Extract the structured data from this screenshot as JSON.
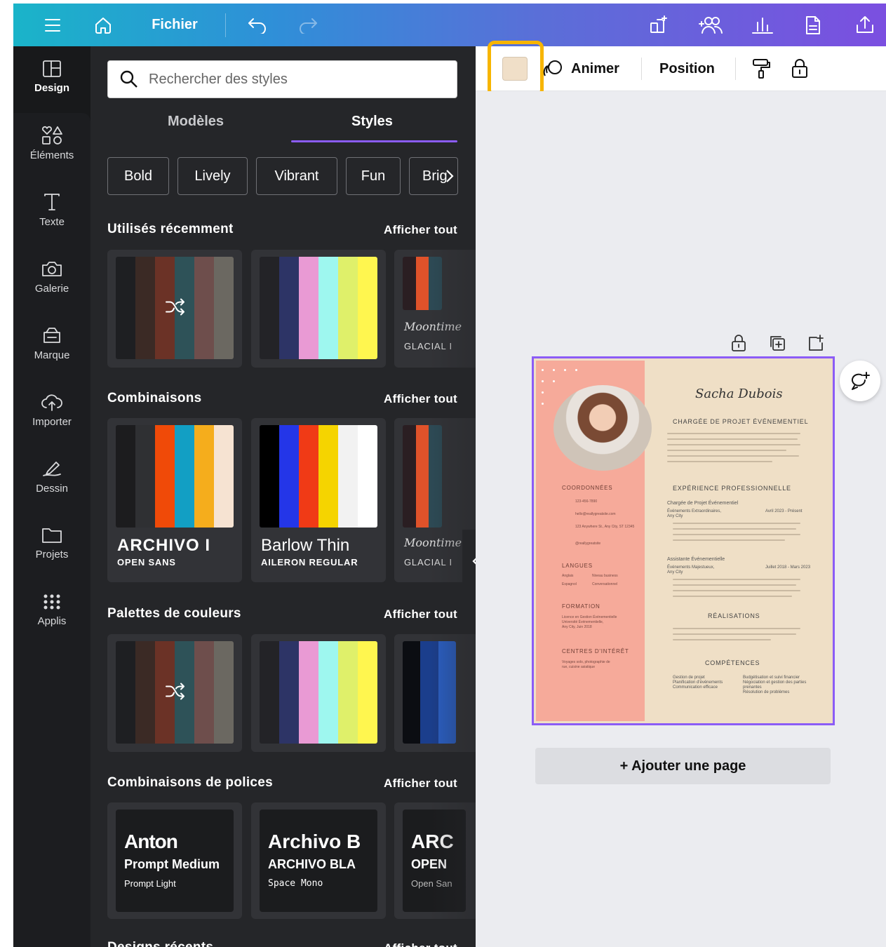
{
  "topbar": {
    "file_label": "Fichier",
    "icons": [
      "menu-icon",
      "home-icon",
      "undo-icon",
      "redo-icon",
      "resize-icon",
      "share-people-icon",
      "insights-icon",
      "notes-icon",
      "export-icon"
    ]
  },
  "rail": {
    "items": [
      {
        "label": "Design",
        "icon": "layout-icon"
      },
      {
        "label": "Éléments",
        "icon": "shapes-icon"
      },
      {
        "label": "Texte",
        "icon": "text-icon"
      },
      {
        "label": "Galerie",
        "icon": "camera-icon"
      },
      {
        "label": "Marque",
        "icon": "brand-icon"
      },
      {
        "label": "Importer",
        "icon": "upload-cloud-icon"
      },
      {
        "label": "Dessin",
        "icon": "draw-icon"
      },
      {
        "label": "Projets",
        "icon": "folder-icon"
      },
      {
        "label": "Applis",
        "icon": "apps-grid-icon"
      }
    ]
  },
  "panel": {
    "search_placeholder": "Rechercher des styles",
    "tabs": [
      "Modèles",
      "Styles"
    ],
    "active_tab": "Styles",
    "chips": [
      "Bold",
      "Lively",
      "Vibrant",
      "Fun",
      "Brig"
    ],
    "sections": {
      "recent": {
        "title": "Utilisés récemment",
        "link": "Afficher tout"
      },
      "combos": {
        "title": "Combinaisons",
        "link": "Afficher tout"
      },
      "palettes": {
        "title": "Palettes de couleurs",
        "link": "Afficher tout"
      },
      "fonts": {
        "title": "Combinaisons de polices",
        "link": "Afficher tout"
      },
      "next": {
        "title": "Designs récents",
        "link": "Afficher tout"
      }
    },
    "palette_a": [
      "#1e1f22",
      "#3b2a25",
      "#6b3226",
      "#2e5258",
      "#6e4e4c",
      "#6b6861"
    ],
    "palette_b": [
      "#232327",
      "#2d3466",
      "#e99ad4",
      "#9ef7ef",
      "#dff06a",
      "#fff64f"
    ],
    "palette_c": [
      "#2a1e22",
      "#e0522a",
      "#2d4a55"
    ],
    "palette_combo_a": [
      "#1c1c1e",
      "#2f3033",
      "#f04a08",
      "#129fc4",
      "#f5ad1c",
      "#f6e3d2"
    ],
    "palette_combo_b": [
      "#000000",
      "#2436e8",
      "#f03a16",
      "#f5d400",
      "#f2f2f2",
      "#ffffff"
    ],
    "palette_d": [
      "#0b0d12",
      "#1b3e8c",
      "#2a5fc4"
    ],
    "recent_third_script": "Moontime",
    "recent_third_font": "GLACIAL I",
    "combo_cards": [
      {
        "main": "ARCHIVO I",
        "sub": "OPEN SANS"
      },
      {
        "main": "Barlow Thin",
        "sub": "AILERON REGULAR"
      },
      {
        "main": "Moontime",
        "sub": "GLACIAL I"
      }
    ],
    "font_pairs": [
      {
        "l1": "Anton",
        "l2": "Prompt Medium",
        "l3": "Prompt Light"
      },
      {
        "l1": "Archivo B",
        "l2": "ARCHIVO BLA",
        "l3": "Space  Mono"
      },
      {
        "l1": "ARC",
        "l2": "OPEN",
        "l3": "Open San"
      }
    ]
  },
  "context_bar": {
    "color_value": "#f0dfc8",
    "animate_label": "Animer",
    "position_label": "Position"
  },
  "canvas": {
    "add_page_label": "+ Ajouter une page",
    "resume": {
      "name": "Sacha Dubois",
      "headline": "CHARGÉE DE PROJET ÉVÉNEMENTIEL",
      "left_sections": [
        "COORDONNÉES",
        "LANGUES",
        "FORMATION",
        "CENTRES D'INTÉRÊT"
      ],
      "contacts": [
        "123-456-7890",
        "hello@reallygreatsite.com",
        "123 Anywhere St., Any City, ST 12345",
        "@reallygreatsite"
      ],
      "languages": [
        [
          "Anglais",
          "Niveau business"
        ],
        [
          "Espagnol",
          "Conversationnel"
        ]
      ],
      "formation": [
        "Licence en Gestion Événementielle",
        "Université Événementielle,",
        "Any City, Juin 2018"
      ],
      "interests": [
        "Voyages solo, photographie de",
        "rue, cuisine asiatique"
      ],
      "right_sections": [
        "EXPÉRIENCE PROFESSIONNELLE",
        "RÉALISATIONS",
        "COMPÉTENCES"
      ],
      "jobs": [
        {
          "title": "Chargée de Projet Événementiel",
          "company": "Événements Extraordinaires,",
          "city": "Any City",
          "dates": "Avril 2023 - Présent"
        },
        {
          "title": "Assistante Événementielle",
          "company": "Événements Majestueux,",
          "city": "Any City",
          "dates": "Juillet 2018 - Mars 2023"
        }
      ],
      "skills_left": [
        "Gestion de projet",
        "Planification d'événements",
        "Communication efficace"
      ],
      "skills_right": [
        "Budgétisation et suivi financier",
        "Négociation et gestion des parties",
        "prenantes",
        "Résolution de problèmes"
      ]
    }
  }
}
